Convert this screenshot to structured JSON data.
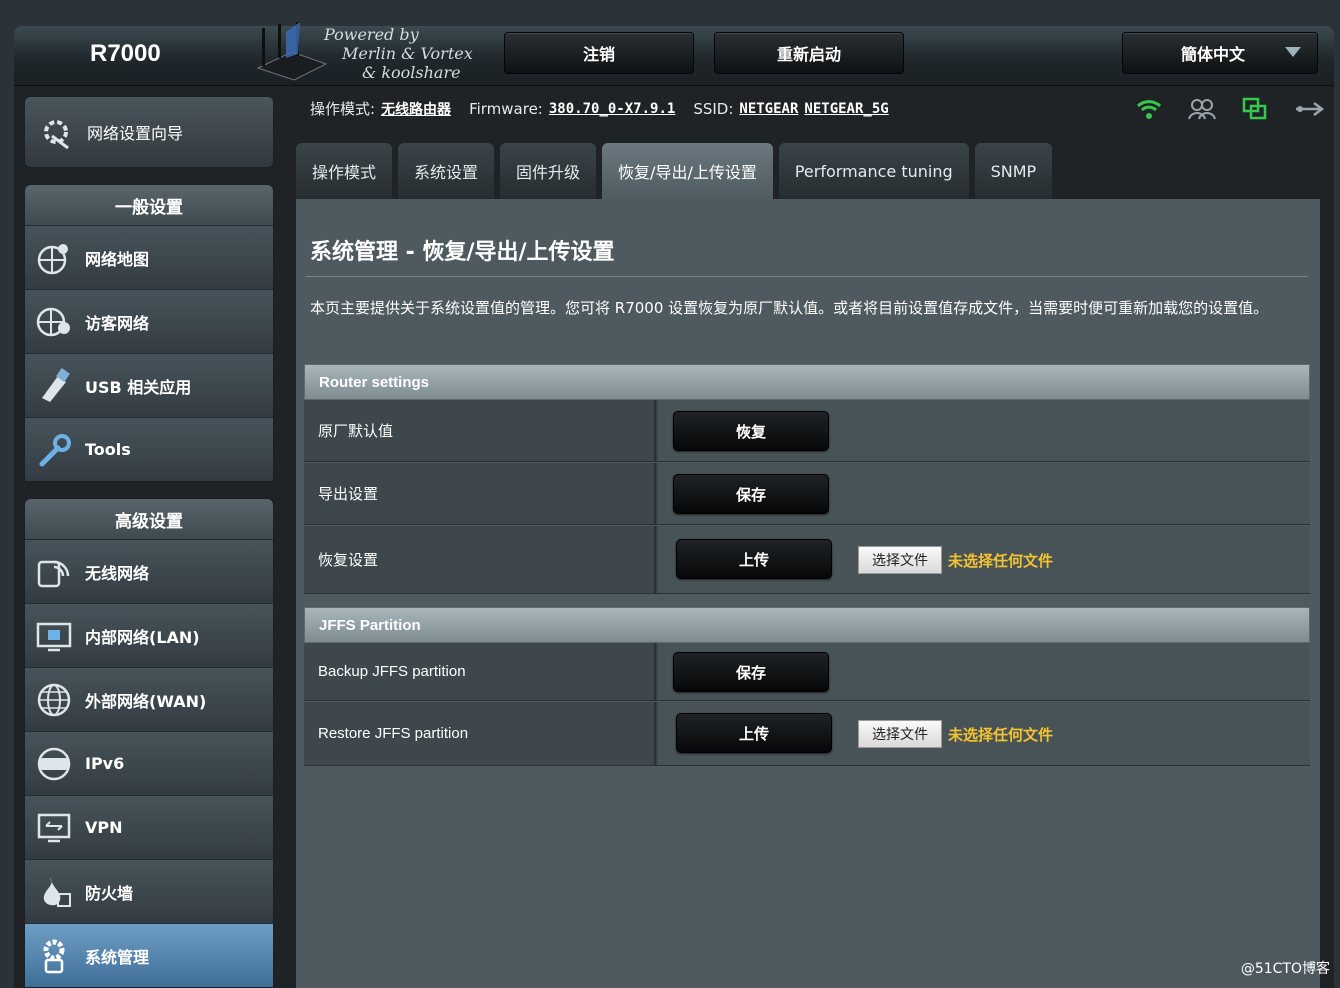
{
  "header": {
    "model": "R7000",
    "powered_by": [
      "Powered by",
      "Merlin & Vortex",
      "& koolshare"
    ],
    "logout": "注销",
    "reboot": "重新启动",
    "language": "簡体中文"
  },
  "sidebar": {
    "wizard": "网络设置向导",
    "general_title": "一般设置",
    "general_items": [
      {
        "label": "网络地图",
        "icon": "network-map-icon"
      },
      {
        "label": "访客网络",
        "icon": "guest-network-icon"
      },
      {
        "label": "USB 相关应用",
        "icon": "usb-app-icon"
      },
      {
        "label": "Tools",
        "icon": "tools-icon"
      }
    ],
    "advanced_title": "高级设置",
    "advanced_items": [
      {
        "label": "无线网络",
        "icon": "wireless-icon"
      },
      {
        "label": "内部网络(LAN)",
        "icon": "lan-icon"
      },
      {
        "label": "外部网络(WAN)",
        "icon": "wan-icon"
      },
      {
        "label": "IPv6",
        "icon": "ipv6-icon"
      },
      {
        "label": "VPN",
        "icon": "vpn-icon"
      },
      {
        "label": "防火墙",
        "icon": "firewall-icon"
      },
      {
        "label": "系统管理",
        "icon": "administration-icon"
      }
    ]
  },
  "info": {
    "mode_label": "操作模式:",
    "mode_value": "无线路由器",
    "firmware_label": "Firmware:",
    "firmware_value": "380.70_0-X7.9.1",
    "ssid_label": "SSID:",
    "ssid_1": "NETGEAR",
    "ssid_2": "NETGEAR_5G"
  },
  "tabs": [
    "操作模式",
    "系统设置",
    "固件升级",
    "恢复/导出/上传设置",
    "Performance tuning",
    "SNMP"
  ],
  "page": {
    "title": "系统管理 - 恢复/导出/上传设置",
    "description": "本页主要提供关于系统设置值的管理。您可将 R7000 设置恢复为原厂默认值。或者将目前设置值存成文件，当需要时便可重新加载您的设置值。"
  },
  "router_settings": {
    "title": "Router settings",
    "rows": [
      {
        "label": "原厂默认值",
        "button": "恢复"
      },
      {
        "label": "导出设置",
        "button": "保存"
      },
      {
        "label": "恢复设置",
        "button": "上传",
        "file_button": "选择文件",
        "file_status": "未选择任何文件"
      }
    ]
  },
  "jffs": {
    "title": "JFFS Partition",
    "rows": [
      {
        "label": "Backup JFFS partition",
        "button": "保存"
      },
      {
        "label": "Restore JFFS partition",
        "button": "上传",
        "file_button": "选择文件",
        "file_status": "未选择任何文件"
      }
    ]
  },
  "watermark": "@51CTO博客",
  "colors": {
    "accent": "#f4c330",
    "wifi": "#35c84a",
    "active_nav": "#5a8db5"
  }
}
